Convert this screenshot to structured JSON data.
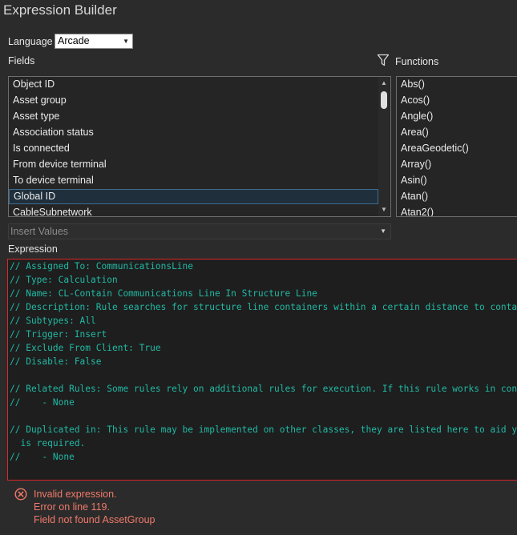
{
  "window": {
    "title": "Expression Builder"
  },
  "language": {
    "label": "Language",
    "selected": "Arcade"
  },
  "fields": {
    "label": "Fields",
    "items": [
      "Object ID",
      "Asset group",
      "Asset type",
      "Association status",
      "Is connected",
      "From device terminal",
      "To device terminal",
      "Global ID",
      "CableSubnetwork"
    ],
    "selected_index": 7
  },
  "functions": {
    "label": "Functions",
    "items": [
      "Abs()",
      "Acos()",
      "Angle()",
      "Area()",
      "AreaGeodetic()",
      "Array()",
      "Asin()",
      "Atan()",
      "Atan2()"
    ]
  },
  "insert_values": {
    "placeholder": "Insert Values"
  },
  "expression": {
    "label": "Expression",
    "lines": [
      "// Assigned To: CommunicationsLine",
      "// Type: Calculation",
      "// Name: CL-Contain Communications Line In Structure Line",
      "// Description: Rule searches for structure line containers within a certain distance to contain",
      "// Subtypes: All",
      "// Trigger: Insert",
      "// Exclude From Client: True",
      "// Disable: False",
      "",
      "// Related Rules: Some rules rely on additional rules for execution. If this rule works in conju",
      "//    - None",
      "",
      "// Duplicated in: This rule may be implemented on other classes, they are listed here to aid you",
      "  is required.",
      "//    - None"
    ]
  },
  "error": {
    "lines": [
      "Invalid expression.",
      "Error on line 119.",
      "Field not found AssetGroup"
    ],
    "color": "#f07a6a"
  },
  "icons": {
    "filter": "filter-icon",
    "error": "error-icon",
    "dropdown": "chevron-down-icon"
  }
}
